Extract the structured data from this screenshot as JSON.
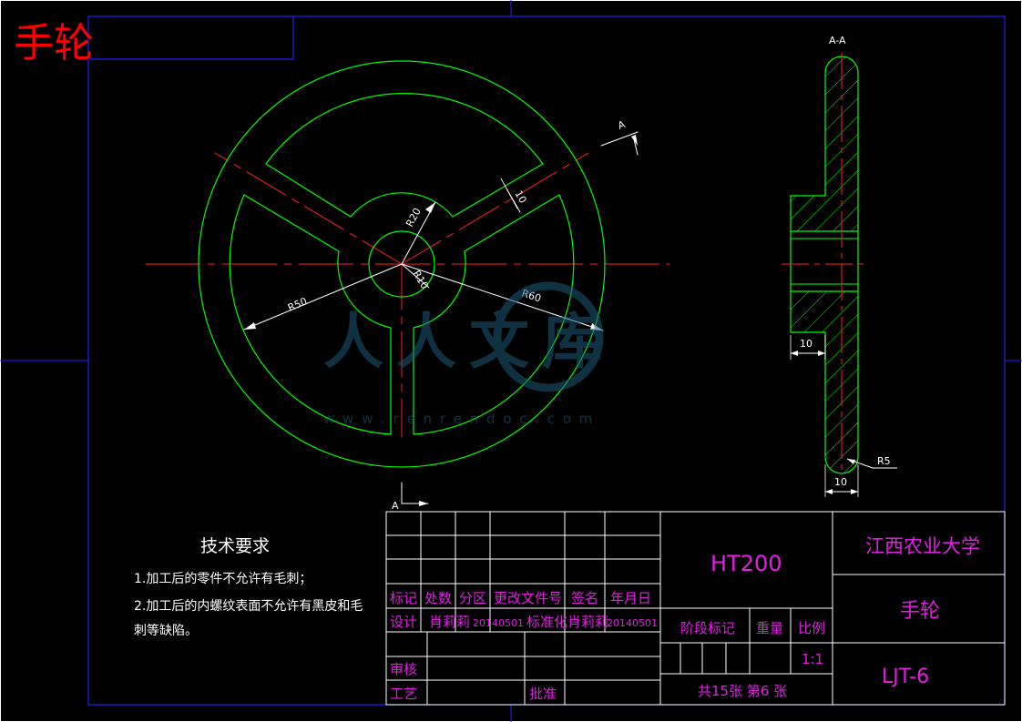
{
  "header": {
    "title": "手轮"
  },
  "views": {
    "section_label": "A-A",
    "cut_mark": "A"
  },
  "dimensions": {
    "r20": "R20",
    "r10": "R10",
    "r50": "R50",
    "r60": "R60",
    "spoke_width": "10",
    "hub_step": "10",
    "rim_width": "10",
    "fillet": "R5"
  },
  "notes": {
    "title": "技术要求",
    "items": [
      "1.加工后的零件不允许有毛刺；",
      "2.加工后的内螺纹表面不允许有黑皮和毛",
      "刺等缺陷。"
    ]
  },
  "title_block": {
    "material": "HT200",
    "school": "江西农业大学",
    "part_name": "手轮",
    "drawing_no": "LJT-6",
    "headers": [
      "标记",
      "处数",
      "分区",
      "更改文件号",
      "签名",
      "年月日"
    ],
    "design_label": "设计",
    "designer": "肖莉莉",
    "design_date": "20140501",
    "standardize_label": "标准化",
    "standardizer": "肖莉莉",
    "standardize_date": "20140501",
    "stage_label": "阶段标记",
    "weight_label": "重量",
    "scale_label": "比例",
    "scale": "1:1",
    "review_label": "审核",
    "process_label": "工艺",
    "approve_label": "批准",
    "sheets": "共15张 第6 张"
  },
  "watermark": {
    "text": "人人文库",
    "url": "w w w . r e n r e n d o c . c o m"
  },
  "colors": {
    "background": "#000000",
    "outline": "#00ff00",
    "centerline": "#ff2020",
    "border": "#2020ff",
    "dimension": "#ffffff",
    "text": "#e020e0",
    "title_red": "#ff0000"
  }
}
